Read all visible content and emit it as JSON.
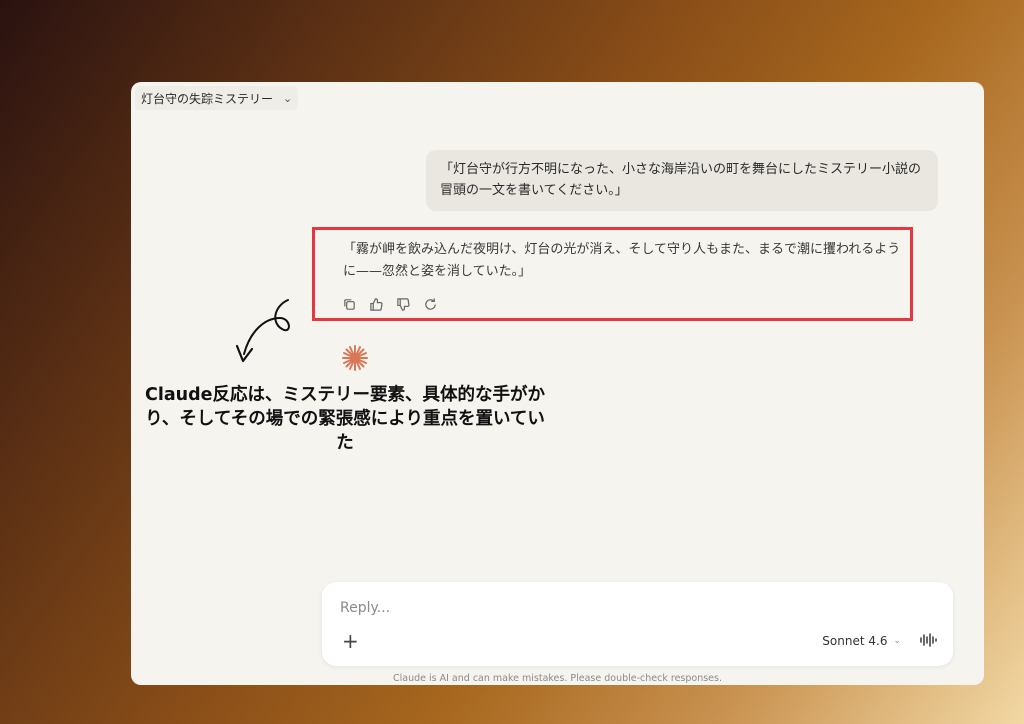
{
  "header": {
    "conversation_title": "灯台守の失踪ミステリー",
    "chevron_icon": "chevron-down-icon"
  },
  "conversation": {
    "user_message": "「灯台守が行方不明になった、小さな海岸沿いの町を舞台にしたミステリー小説の冒頭の一文を書いてください。」",
    "assistant_message": "「霧が岬を飲み込んだ夜明け、灯台の光が消え、そして守り人もまた、まるで潮に攫われるように——忽然と姿を消していた。」",
    "actions": [
      "copy-icon",
      "thumbs-up-icon",
      "thumbs-down-icon",
      "retry-icon"
    ],
    "highlight_color": "#e5373f",
    "spark_color": "#d97757"
  },
  "annotation": {
    "text": "Claude反応は、ミステリー要素、具体的な手がかり、そしてその場での緊張感により重点を置いていた"
  },
  "composer": {
    "placeholder": "Reply...",
    "plus_icon": "plus-icon",
    "model_label": "Sonnet 4.6",
    "voice_icon": "voice-icon"
  },
  "footer": {
    "disclaimer": "Claude is AI and can make mistakes. Please double-check responses."
  }
}
